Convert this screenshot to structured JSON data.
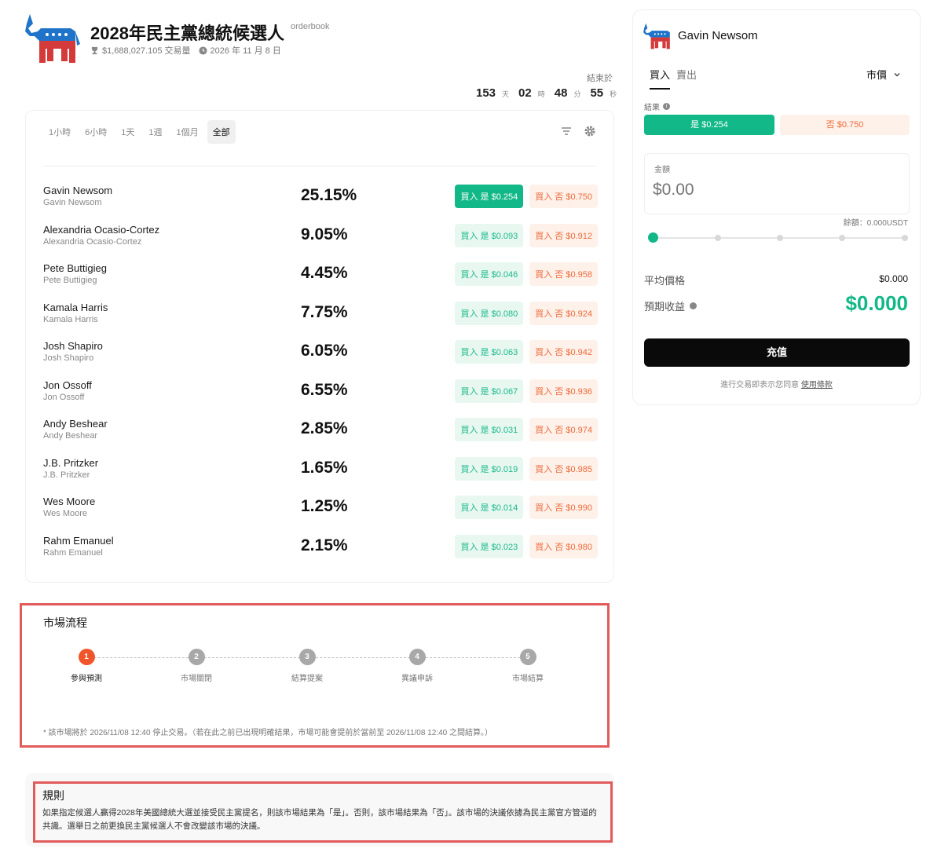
{
  "header": {
    "title": "2028年民主黨總統候選人",
    "tag": "orderbook",
    "volume": "$1,688,027.105 交易量",
    "date": "2026 年 11 月 8 日",
    "countdown_label": "結束於",
    "countdown": {
      "days": "153",
      "days_unit": "天",
      "hours": "02",
      "hours_unit": "時",
      "minutes": "48",
      "minutes_unit": "分",
      "seconds": "55",
      "seconds_unit": "秒"
    }
  },
  "timeframes": [
    "1小時",
    "6小時",
    "1天",
    "1週",
    "1個月",
    "全部"
  ],
  "active_timeframe": "全部",
  "outcomes": [
    {
      "name": "Gavin Newsom",
      "sub": "Gavin Newsom",
      "pct": "25.15%",
      "yes": "買入 是 $0.254",
      "no": "買入 否 $0.750"
    },
    {
      "name": "Alexandria Ocasio-Cortez",
      "sub": "Alexandria Ocasio-Cortez",
      "pct": "9.05%",
      "yes": "買入 是 $0.093",
      "no": "買入 否 $0.912"
    },
    {
      "name": "Pete Buttigieg",
      "sub": "Pete Buttigieg",
      "pct": "4.45%",
      "yes": "買入 是 $0.046",
      "no": "買入 否 $0.958"
    },
    {
      "name": "Kamala Harris",
      "sub": "Kamala Harris",
      "pct": "7.75%",
      "yes": "買入 是 $0.080",
      "no": "買入 否 $0.924"
    },
    {
      "name": "Josh Shapiro",
      "sub": "Josh Shapiro",
      "pct": "6.05%",
      "yes": "買入 是 $0.063",
      "no": "買入 否 $0.942"
    },
    {
      "name": "Jon Ossoff",
      "sub": "Jon Ossoff",
      "pct": "6.55%",
      "yes": "買入 是 $0.067",
      "no": "買入 否 $0.936"
    },
    {
      "name": "Andy Beshear",
      "sub": "Andy Beshear",
      "pct": "2.85%",
      "yes": "買入 是 $0.031",
      "no": "買入 否 $0.974"
    },
    {
      "name": "J.B. Pritzker",
      "sub": "J.B. Pritzker",
      "pct": "1.65%",
      "yes": "買入 是 $0.019",
      "no": "買入 否 $0.985"
    },
    {
      "name": "Wes Moore",
      "sub": "Wes Moore",
      "pct": "1.25%",
      "yes": "買入 是 $0.014",
      "no": "買入 否 $0.990"
    },
    {
      "name": "Rahm Emanuel",
      "sub": "Rahm Emanuel",
      "pct": "2.15%",
      "yes": "買入 是 $0.023",
      "no": "買入 否 $0.980"
    }
  ],
  "process": {
    "title": "市場流程",
    "steps": [
      {
        "num": "1",
        "label": "參與預測"
      },
      {
        "num": "2",
        "label": "市場關閉"
      },
      {
        "num": "3",
        "label": "結算提案"
      },
      {
        "num": "4",
        "label": "異議申訴"
      },
      {
        "num": "5",
        "label": "市場結算"
      }
    ],
    "note": "* 該市場將於 2026/11/08 12:40 停止交易。（若在此之前已出現明確結果，市場可能會提前於當前至 2026/11/08 12:40 之間結算。）"
  },
  "rules": {
    "title": "規則",
    "text": "如果指定候選人贏得2028年美國總統大選並接受民主黨提名，則該市場結果為「是」。否則，該市場結果為「否」。該市場的決議依據為民主黨官方管道的共識。選舉日之前更換民主黨候選人不會改變該市場的決議。"
  },
  "panel": {
    "candidate": "Gavin Newsom",
    "tab_buy": "買入",
    "tab_sell": "賣出",
    "order_type": "市價",
    "outcome_label": "結果",
    "yes_btn": "是 $0.254",
    "no_btn": "否 $0.750",
    "amount_label": "金額",
    "amount_placeholder": "$0.00",
    "balance": "餘額：0.000USDT",
    "slider_value": 0,
    "avg_label": "平均價格",
    "avg_value": "$0.000",
    "return_label": "預期收益",
    "return_value": "$0.000",
    "deposit": "充值",
    "terms_prefix": "進行交易即表示您同意",
    "terms_link": "使用條款"
  },
  "colors": {
    "accent_green": "#12b887",
    "no_orange": "#ef6a3a",
    "highlight_red": "#e15b5b",
    "step_active": "#f0552b"
  }
}
